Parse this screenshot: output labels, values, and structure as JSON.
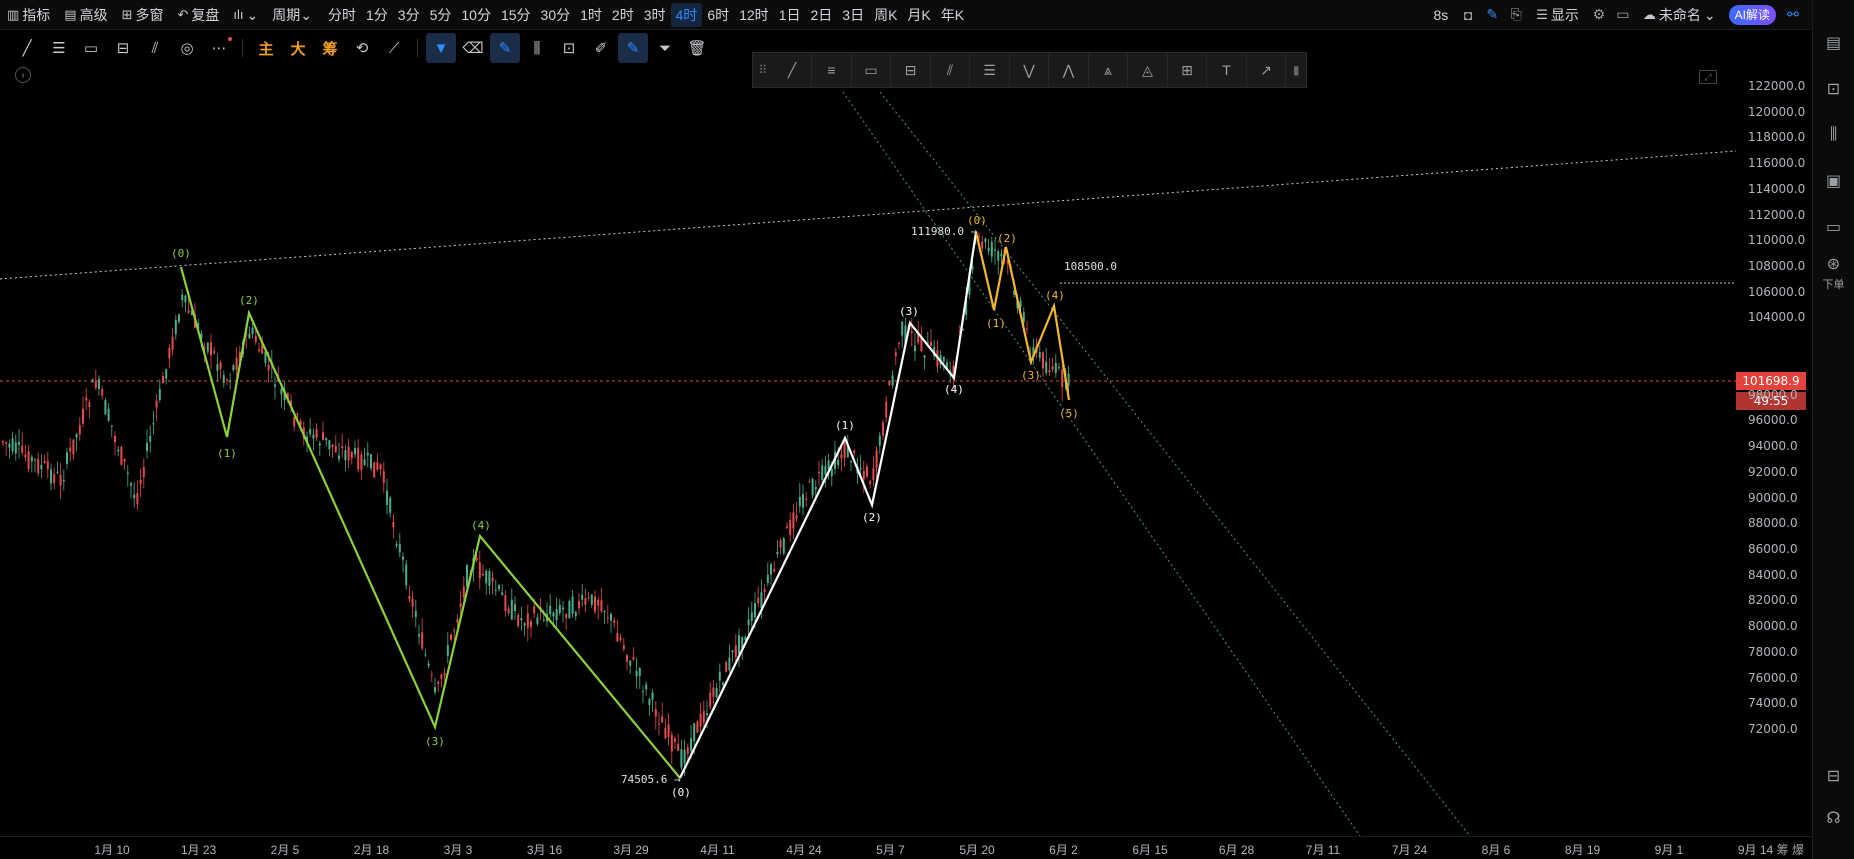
{
  "topbar": {
    "items": [
      {
        "icon": "▥",
        "label": "指标"
      },
      {
        "icon": "▤",
        "label": "高级"
      },
      {
        "icon": "⊞",
        "label": "多窗"
      },
      {
        "icon": "↶",
        "label": "复盘"
      },
      {
        "icon": "ılı",
        "label": "⌄"
      },
      {
        "icon": "",
        "label": "周期⌄"
      }
    ],
    "periods": [
      "分时",
      "1分",
      "3分",
      "5分",
      "10分",
      "15分",
      "30分",
      "1时",
      "2时",
      "3时",
      "4时",
      "6时",
      "12时",
      "1日",
      "2日",
      "3日",
      "周K",
      "月K",
      "年K"
    ],
    "active_period": "4时",
    "right": {
      "interval": "8s",
      "display": "显示",
      "layout_name": "未命名",
      "ai_label": "AI解读"
    }
  },
  "drawbar": {
    "text_tools": [
      "主",
      "大",
      "筹"
    ]
  },
  "price_axis": {
    "labels": [
      "122000.0",
      "120000.0",
      "118000.0",
      "116000.0",
      "114000.0",
      "112000.0",
      "110000.0",
      "108000.0",
      "106000.0",
      "104000.0",
      "98000.0",
      "96000.0",
      "94000.0",
      "92000.0",
      "90000.0",
      "88000.0",
      "86000.0",
      "84000.0",
      "82000.0",
      "80000.0",
      "78000.0",
      "76000.0",
      "74000.0",
      "72000.0"
    ],
    "current_price": "101698.9",
    "countdown": "49:55",
    "current_color": "#e5423c"
  },
  "time_axis": {
    "labels": [
      "1月 10",
      "1月 23",
      "2月 5",
      "2月 18",
      "3月 3",
      "3月 16",
      "3月 29",
      "4月 11",
      "4月 24",
      "5月 7",
      "5月 20",
      "6月 2",
      "6月 15",
      "6月 28",
      "7月 11",
      "7月 24",
      "8月 6",
      "8月 19",
      "9月 1",
      "9月 14"
    ],
    "corner": "筹 爆"
  },
  "annotations": {
    "high_price": "111980.0 →",
    "low_price": "74505.6 →",
    "level_price": "108500.0",
    "green_wave": [
      "(0)",
      "(1)",
      "(2)",
      "(3)",
      "(4)"
    ],
    "white_wave": [
      "(0)",
      "(1)",
      "(2)",
      "(3)",
      "(4)"
    ],
    "orange_wave": [
      "(0)",
      "(1)",
      "(2)",
      "(3)",
      "(4)",
      "(5)"
    ]
  },
  "sidebar": {
    "order_label": "下单"
  },
  "colors": {
    "green_wave": "#8bd13a",
    "white_wave": "#ffffff",
    "orange_wave": "#f2b830",
    "up_candle": "#4caf8a",
    "down_candle": "#e84b4b",
    "accent": "#2a8cff"
  }
}
